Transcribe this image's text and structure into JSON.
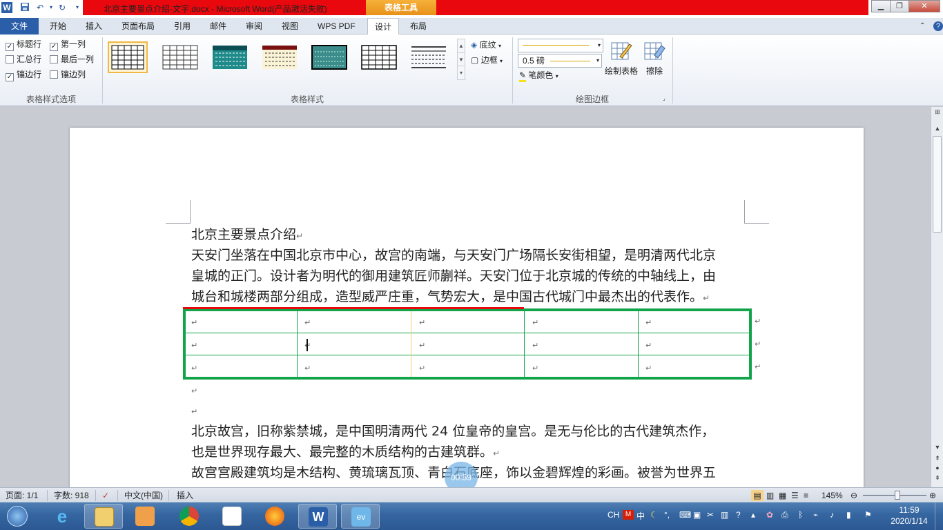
{
  "titlebar": {
    "title": "北京主要景点介绍-文字.docx  -  Microsoft Word(产品激活失败)",
    "context_tab": "表格工具"
  },
  "tabs": [
    "文件",
    "开始",
    "插入",
    "页面布局",
    "引用",
    "邮件",
    "审阅",
    "视图",
    "WPS PDF",
    "设计",
    "布局"
  ],
  "ribbon": {
    "options": {
      "header_row": "标题行",
      "first_column": "第一列",
      "total_row": "汇总行",
      "last_column": "最后一列",
      "banded_rows": "镶边行",
      "banded_columns": "镶边列",
      "group_label": "表格样式选项"
    },
    "styles": {
      "group_label": "表格样式"
    },
    "shading_label": "底纹",
    "borders_label": "边框",
    "pen_weight": "0.5 磅",
    "pen_color_label": "笔颜色",
    "draw_table_label": "绘制表格",
    "eraser_label": "擦除",
    "draw_group_label": "绘图边框"
  },
  "document": {
    "heading": "北京主要景点介绍",
    "para1_lines": [
      "天安门坐落在中国北京市中心，故宫的南端，与天安门广场隔长安街相望，是明清两代北京",
      "皇城的正门。设计者为明代的御用建筑匠师蒯祥。天安门位于北京城的传统的中轴线上，由",
      "城台和城楼两部分组成，造型威严庄重，气势宏大，是中国古代城门中最杰出的代表作。"
    ],
    "para2_lines": [
      "北京故宫，旧称紫禁城，是中国明清两代 24 位皇帝的皇宫。是无与伦比的古代建筑杰作，",
      "也是世界现存最大、最完整的木质结构的古建筑群。"
    ],
    "para3_line": "故宫宫殿建筑均是木结构、黄琉璃瓦顶、青白石底座，饰以金碧辉煌的彩画。被誉为世界五",
    "table": {
      "rows": 3,
      "cols": 5
    },
    "recording_timer": "00:59"
  },
  "statusbar": {
    "page": "页面: 1/1",
    "words": "字数: 918",
    "language": "中文(中国)",
    "mode": "插入",
    "zoom": "145%",
    "zoom_value": 1.45
  },
  "taskbar": {
    "tray_lang": "CH",
    "time": "11:59",
    "date": "2020/1/14"
  },
  "colors": {
    "title_red": "#e8080d",
    "table_border": "#12a44a",
    "file_tab": "#2a5ea8",
    "context_tab": "#f0a02a"
  }
}
